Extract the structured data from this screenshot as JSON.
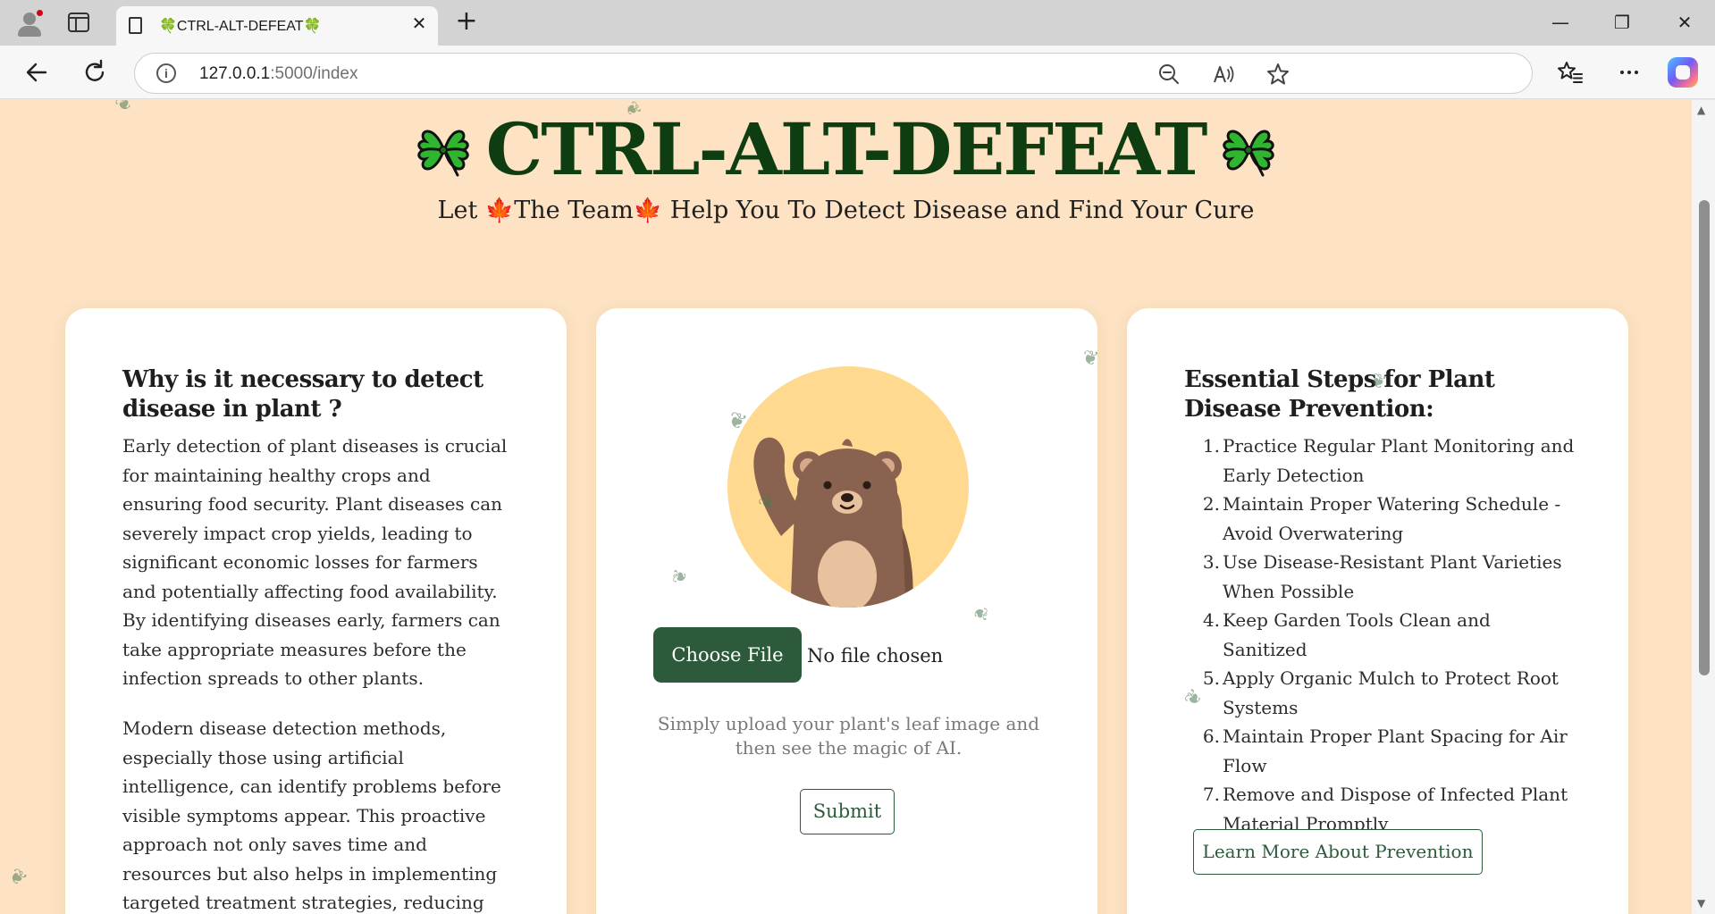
{
  "browser": {
    "tab_title": "🍀CTRL-ALT-DEFEAT🍀",
    "tab_close": "✕",
    "new_tab": "+",
    "url_host": "127.0.0.1",
    "url_path": ":5000/index",
    "info_glyph": "i",
    "window_controls": {
      "minimize": "—",
      "restore": "❐",
      "close": "✕"
    },
    "nav_icons": [
      "back-icon",
      "refresh-icon"
    ],
    "address_icons": [
      "zoom-out-icon",
      "read-aloud-icon",
      "favorite-star-icon"
    ],
    "toolbar_icons": [
      "favorites-icon",
      "more-icon",
      "copilot-icon"
    ]
  },
  "header": {
    "title": "CTRL-ALT-DEFEAT",
    "subtitle_prefix": "Let ",
    "subtitle_team": "The Team",
    "subtitle_suffix": " Help You To Detect Disease and Find Your Cure",
    "maple_glyph": "🍁"
  },
  "left_card": {
    "heading": "Why is it necessary to detect disease in plant ?",
    "paragraph1": "Early detection of plant diseases is crucial for maintaining healthy crops and ensuring food security. Plant diseases can severely impact crop yields, leading to significant economic losses for farmers and potentially affecting food availability. By identifying diseases early, farmers can take appropriate measures before the infection spreads to other plants.",
    "paragraph2": "Modern disease detection methods, especially those using artificial intelligence, can identify problems before visible symptoms appear. This proactive approach not only saves time and resources but also helps in implementing targeted treatment strategies, reducing the need for"
  },
  "center_card": {
    "choose_file_label": "Choose File",
    "no_file_text": "No file chosen",
    "hint": "Simply upload your plant's leaf image and then see the magic of AI.",
    "submit_label": "Submit"
  },
  "right_card": {
    "heading": "Essential Steps for Plant Disease Prevention:",
    "steps": [
      "Practice Regular Plant Monitoring and Early Detection",
      "Maintain Proper Watering Schedule - Avoid Overwatering",
      "Use Disease-Resistant Plant Varieties When Possible",
      "Keep Garden Tools Clean and Sanitized",
      "Apply Organic Mulch to Protect Root Systems",
      "Maintain Proper Plant Spacing for Air Flow",
      "Remove and Dispose of Infected Plant Material Promptly"
    ],
    "learn_more_label": "Learn More About Prevention"
  },
  "colors": {
    "page_bg": "#fde3c3",
    "title_green": "#0f3d12",
    "button_green": "#2d5a3a",
    "bear_bg": "#ffd98f",
    "bear_fur": "#8a6350"
  }
}
